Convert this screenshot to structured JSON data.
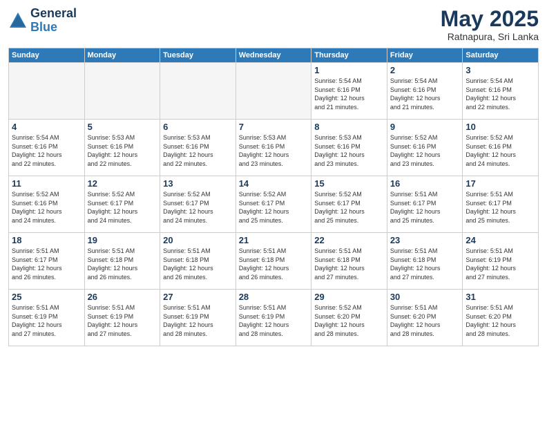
{
  "header": {
    "logo_general": "General",
    "logo_blue": "Blue",
    "month_year": "May 2025",
    "location": "Ratnapura, Sri Lanka"
  },
  "weekdays": [
    "Sunday",
    "Monday",
    "Tuesday",
    "Wednesday",
    "Thursday",
    "Friday",
    "Saturday"
  ],
  "weeks": [
    [
      {
        "day": "",
        "info": ""
      },
      {
        "day": "",
        "info": ""
      },
      {
        "day": "",
        "info": ""
      },
      {
        "day": "",
        "info": ""
      },
      {
        "day": "1",
        "info": "Sunrise: 5:54 AM\nSunset: 6:16 PM\nDaylight: 12 hours\nand 21 minutes."
      },
      {
        "day": "2",
        "info": "Sunrise: 5:54 AM\nSunset: 6:16 PM\nDaylight: 12 hours\nand 21 minutes."
      },
      {
        "day": "3",
        "info": "Sunrise: 5:54 AM\nSunset: 6:16 PM\nDaylight: 12 hours\nand 22 minutes."
      }
    ],
    [
      {
        "day": "4",
        "info": "Sunrise: 5:54 AM\nSunset: 6:16 PM\nDaylight: 12 hours\nand 22 minutes."
      },
      {
        "day": "5",
        "info": "Sunrise: 5:53 AM\nSunset: 6:16 PM\nDaylight: 12 hours\nand 22 minutes."
      },
      {
        "day": "6",
        "info": "Sunrise: 5:53 AM\nSunset: 6:16 PM\nDaylight: 12 hours\nand 22 minutes."
      },
      {
        "day": "7",
        "info": "Sunrise: 5:53 AM\nSunset: 6:16 PM\nDaylight: 12 hours\nand 23 minutes."
      },
      {
        "day": "8",
        "info": "Sunrise: 5:53 AM\nSunset: 6:16 PM\nDaylight: 12 hours\nand 23 minutes."
      },
      {
        "day": "9",
        "info": "Sunrise: 5:52 AM\nSunset: 6:16 PM\nDaylight: 12 hours\nand 23 minutes."
      },
      {
        "day": "10",
        "info": "Sunrise: 5:52 AM\nSunset: 6:16 PM\nDaylight: 12 hours\nand 24 minutes."
      }
    ],
    [
      {
        "day": "11",
        "info": "Sunrise: 5:52 AM\nSunset: 6:16 PM\nDaylight: 12 hours\nand 24 minutes."
      },
      {
        "day": "12",
        "info": "Sunrise: 5:52 AM\nSunset: 6:17 PM\nDaylight: 12 hours\nand 24 minutes."
      },
      {
        "day": "13",
        "info": "Sunrise: 5:52 AM\nSunset: 6:17 PM\nDaylight: 12 hours\nand 24 minutes."
      },
      {
        "day": "14",
        "info": "Sunrise: 5:52 AM\nSunset: 6:17 PM\nDaylight: 12 hours\nand 25 minutes."
      },
      {
        "day": "15",
        "info": "Sunrise: 5:52 AM\nSunset: 6:17 PM\nDaylight: 12 hours\nand 25 minutes."
      },
      {
        "day": "16",
        "info": "Sunrise: 5:51 AM\nSunset: 6:17 PM\nDaylight: 12 hours\nand 25 minutes."
      },
      {
        "day": "17",
        "info": "Sunrise: 5:51 AM\nSunset: 6:17 PM\nDaylight: 12 hours\nand 25 minutes."
      }
    ],
    [
      {
        "day": "18",
        "info": "Sunrise: 5:51 AM\nSunset: 6:17 PM\nDaylight: 12 hours\nand 26 minutes."
      },
      {
        "day": "19",
        "info": "Sunrise: 5:51 AM\nSunset: 6:18 PM\nDaylight: 12 hours\nand 26 minutes."
      },
      {
        "day": "20",
        "info": "Sunrise: 5:51 AM\nSunset: 6:18 PM\nDaylight: 12 hours\nand 26 minutes."
      },
      {
        "day": "21",
        "info": "Sunrise: 5:51 AM\nSunset: 6:18 PM\nDaylight: 12 hours\nand 26 minutes."
      },
      {
        "day": "22",
        "info": "Sunrise: 5:51 AM\nSunset: 6:18 PM\nDaylight: 12 hours\nand 27 minutes."
      },
      {
        "day": "23",
        "info": "Sunrise: 5:51 AM\nSunset: 6:18 PM\nDaylight: 12 hours\nand 27 minutes."
      },
      {
        "day": "24",
        "info": "Sunrise: 5:51 AM\nSunset: 6:19 PM\nDaylight: 12 hours\nand 27 minutes."
      }
    ],
    [
      {
        "day": "25",
        "info": "Sunrise: 5:51 AM\nSunset: 6:19 PM\nDaylight: 12 hours\nand 27 minutes."
      },
      {
        "day": "26",
        "info": "Sunrise: 5:51 AM\nSunset: 6:19 PM\nDaylight: 12 hours\nand 27 minutes."
      },
      {
        "day": "27",
        "info": "Sunrise: 5:51 AM\nSunset: 6:19 PM\nDaylight: 12 hours\nand 28 minutes."
      },
      {
        "day": "28",
        "info": "Sunrise: 5:51 AM\nSunset: 6:19 PM\nDaylight: 12 hours\nand 28 minutes."
      },
      {
        "day": "29",
        "info": "Sunrise: 5:52 AM\nSunset: 6:20 PM\nDaylight: 12 hours\nand 28 minutes."
      },
      {
        "day": "30",
        "info": "Sunrise: 5:51 AM\nSunset: 6:20 PM\nDaylight: 12 hours\nand 28 minutes."
      },
      {
        "day": "31",
        "info": "Sunrise: 5:51 AM\nSunset: 6:20 PM\nDaylight: 12 hours\nand 28 minutes."
      }
    ]
  ]
}
